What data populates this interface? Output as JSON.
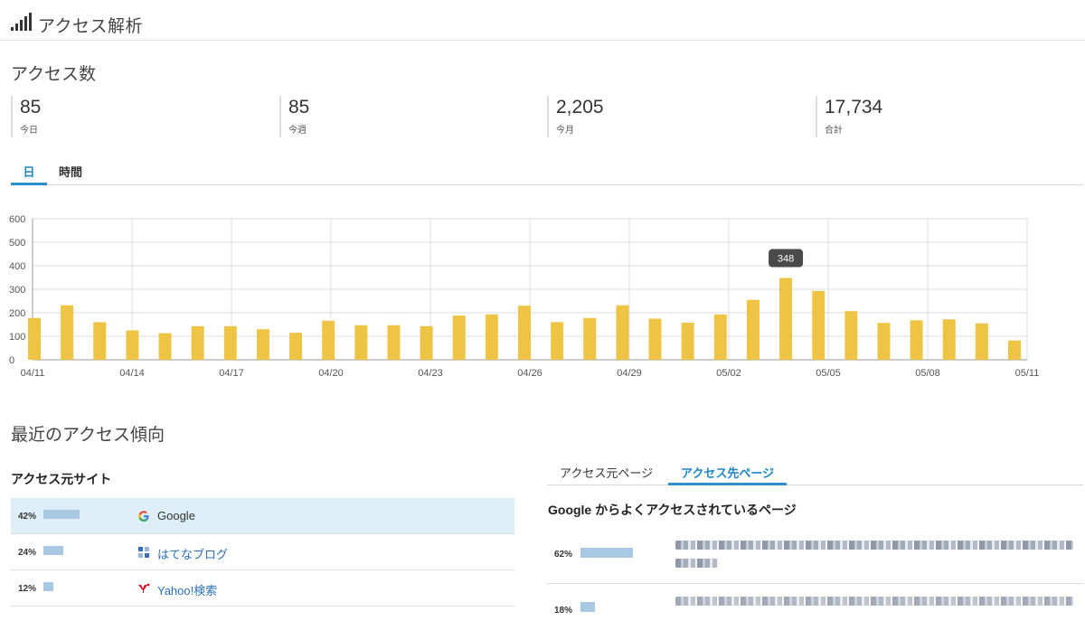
{
  "header": {
    "title": "アクセス解析"
  },
  "access_section": {
    "title": "アクセス数",
    "stats": [
      {
        "value": "85",
        "label": "今日"
      },
      {
        "value": "85",
        "label": "今週"
      },
      {
        "value": "2,205",
        "label": "今月"
      },
      {
        "value": "17,734",
        "label": "合計"
      }
    ],
    "tabs": [
      {
        "label": "日",
        "active": true
      },
      {
        "label": "時間",
        "active": false
      }
    ]
  },
  "chart_data": {
    "type": "bar",
    "categories": [
      "04/11",
      "04/12",
      "04/13",
      "04/14",
      "04/15",
      "04/16",
      "04/17",
      "04/18",
      "04/19",
      "04/20",
      "04/21",
      "04/22",
      "04/23",
      "04/24",
      "04/25",
      "04/26",
      "04/27",
      "04/28",
      "04/29",
      "04/30",
      "05/01",
      "05/02",
      "05/03",
      "05/04",
      "05/05",
      "05/06",
      "05/07",
      "05/08",
      "05/09",
      "05/10",
      "05/11"
    ],
    "values": [
      178,
      232,
      160,
      125,
      113,
      143,
      143,
      130,
      115,
      166,
      147,
      147,
      143,
      188,
      193,
      230,
      160,
      178,
      232,
      175,
      158,
      193,
      255,
      348,
      293,
      207,
      157,
      168,
      172,
      155,
      82
    ],
    "ylim": [
      0,
      600
    ],
    "yticks": [
      "0",
      "100",
      "200",
      "300",
      "400",
      "500",
      "600"
    ],
    "xtick_labels": [
      "04/11",
      "04/14",
      "04/17",
      "04/20",
      "04/23",
      "04/26",
      "04/29",
      "05/02",
      "05/05",
      "05/08",
      "05/11"
    ],
    "tooltip": {
      "category": "05/04",
      "text": "348"
    },
    "bar_color": "#eec445",
    "grid": true
  },
  "trend_section": {
    "title": "最近のアクセス傾向",
    "referrer_title": "アクセス元サイト",
    "referrers": [
      {
        "pct": "42%",
        "ratio": 0.42,
        "name": "Google",
        "icon": "google-icon"
      },
      {
        "pct": "24%",
        "ratio": 0.24,
        "name": "はてなブログ",
        "icon": "hatena-blog-icon"
      },
      {
        "pct": "12%",
        "ratio": 0.12,
        "name": "Yahoo!検索",
        "icon": "yahoo-icon"
      }
    ],
    "page_tabs": [
      {
        "label": "アクセス元ページ",
        "active": false
      },
      {
        "label": "アクセス先ページ",
        "active": true
      }
    ],
    "pages_title": "Google からよくアクセスされているページ",
    "pages": [
      {
        "pct": "62%",
        "ratio": 0.62
      },
      {
        "pct": "18%",
        "ratio": 0.18
      }
    ]
  },
  "colors": {
    "accent": "#2f8fcf",
    "bar": "#eec445",
    "ref_bar": "#a8c8e4",
    "highlight": "#deeef6"
  }
}
